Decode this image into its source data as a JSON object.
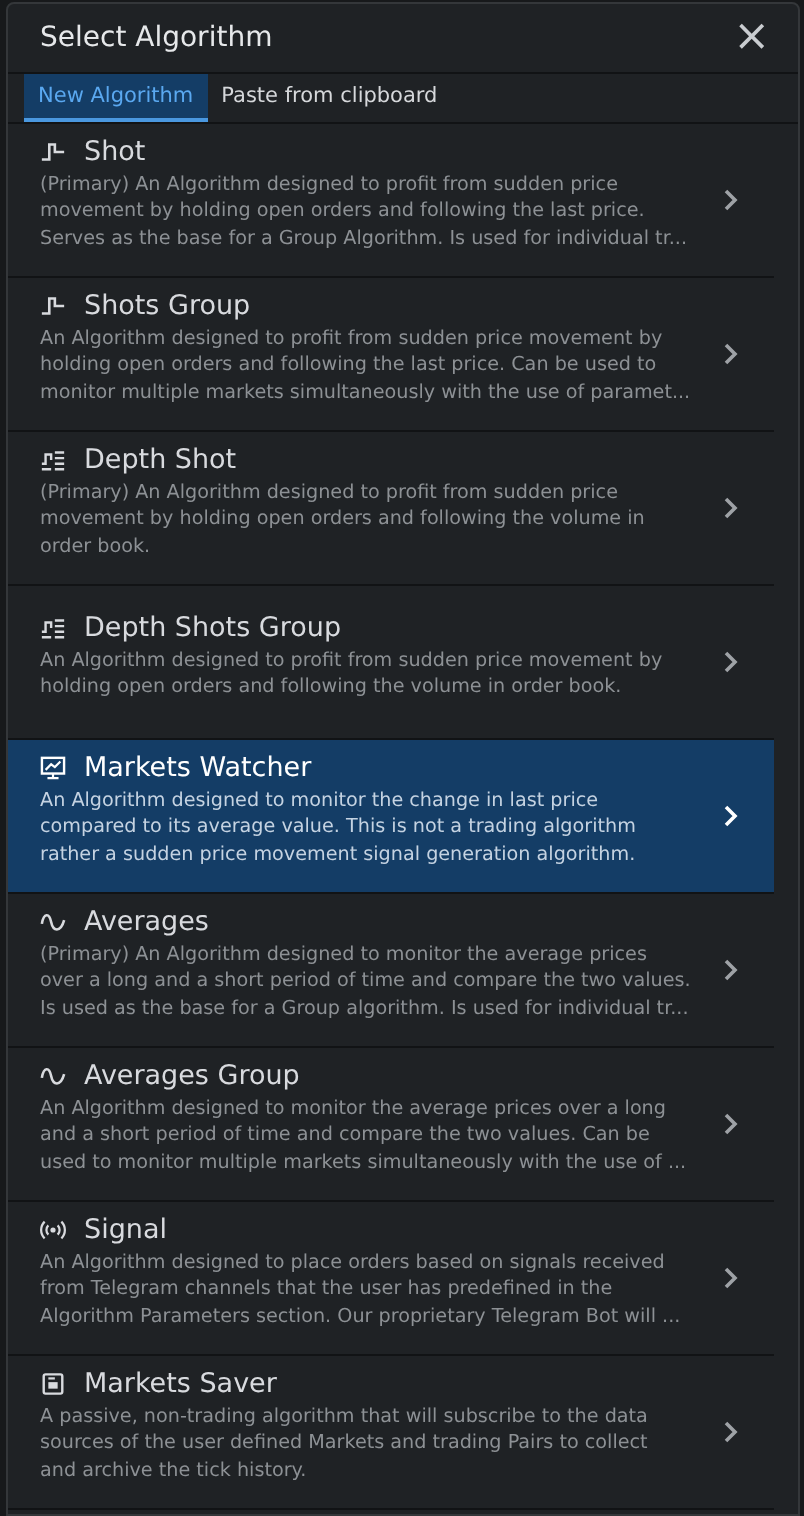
{
  "dialog": {
    "title": "Select Algorithm",
    "close": "×"
  },
  "tabs": [
    {
      "label": "New Algorithm",
      "selected": true
    },
    {
      "label": "Paste from clipboard",
      "selected": false
    }
  ],
  "algorithms": [
    {
      "name": "Shot",
      "selected": false,
      "description": [
        "(Primary) An Algorithm designed to profit from sudden price",
        "movement by holding open orders and following the last price.",
        "Serves as the base for a Group Algorithm. Is used for individual tr..."
      ]
    },
    {
      "name": "Shots Group",
      "selected": false,
      "description": [
        "An Algorithm designed to profit from sudden price movement by",
        "holding open orders and following the last price. Can be used to",
        "monitor multiple markets simultaneously with the use of paramet..."
      ]
    },
    {
      "name": "Depth Shot",
      "selected": false,
      "description": [
        "(Primary) An Algorithm designed to profit from sudden price",
        "movement by holding open orders and following the volume in",
        "order book."
      ]
    },
    {
      "name": "Depth Shots Group",
      "selected": false,
      "description": [
        "An Algorithm designed to profit from sudden price movement by",
        "holding open orders and following the volume in order book."
      ]
    },
    {
      "name": "Markets Watcher",
      "selected": true,
      "description": [
        "An Algorithm designed to monitor the change in last price",
        "compared to its average value. This is not a trading algorithm",
        "rather a sudden price movement signal generation algorithm."
      ]
    },
    {
      "name": "Averages",
      "selected": false,
      "description": [
        "(Primary) An Algorithm designed to monitor the average prices",
        "over a long and a short period of time and compare the two values.",
        "Is used as the base for a Group algorithm. Is used for individual tr..."
      ]
    },
    {
      "name": "Averages Group",
      "selected": false,
      "description": [
        "An Algorithm designed to monitor the average prices over a long",
        "and a short period of time and compare the two values. Can be",
        "used to monitor multiple markets simultaneously with the use of ..."
      ]
    },
    {
      "name": "Signal",
      "selected": false,
      "description": [
        "An Algorithm designed to place orders based on signals received",
        "from Telegram channels that the user has predefined in the",
        "Algorithm Parameters section. Our proprietary Telegram Bot will ..."
      ]
    },
    {
      "name": "Markets Saver",
      "selected": false,
      "description": [
        "A passive, non-trading algorithm that will subscribe to the data",
        "sources of the user defined Markets and trading Pairs to collect",
        "and archive the tick history."
      ]
    }
  ]
}
